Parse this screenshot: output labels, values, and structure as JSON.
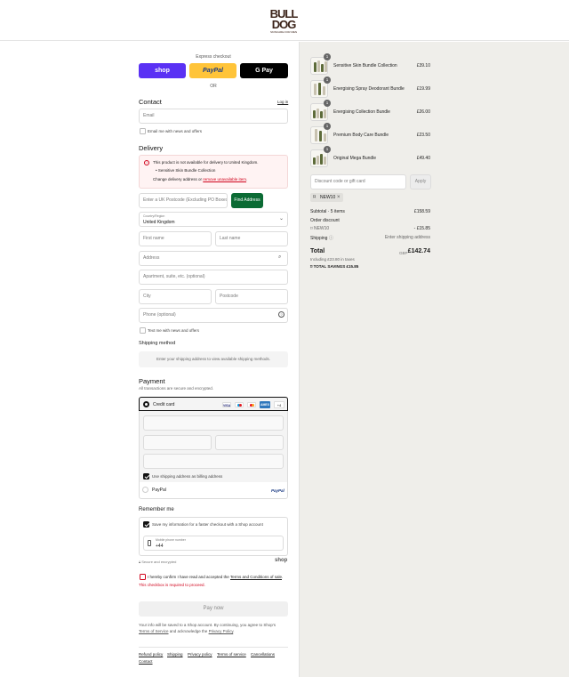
{
  "brand": {
    "logo_line1": "BULL",
    "logo_line2": "DOG",
    "logo_tagline": "SKINCARE FOR MEN",
    "logo_color": "#3b2319"
  },
  "express": {
    "label": "Express checkout",
    "shop_label": "shop",
    "paypal_label": "PayPal",
    "gpay_label": "G Pay",
    "or_label": "OR"
  },
  "contact": {
    "title": "Contact",
    "login_link": "Log in",
    "email_placeholder": "Email",
    "news_label": "Email me with news and offers",
    "news_checked": false
  },
  "delivery": {
    "title": "Delivery",
    "warning_title": "This product is not available for delivery to United Kingdom.",
    "warning_item": "Sensitive Skin Bundle Collection",
    "warning_change_prefix": "Change delivery address or ",
    "warning_change_link": "remove unavailable item",
    "warning_change_suffix": ".",
    "postcode_placeholder": "Enter a UK Postcode (Excluding PO Boxes)",
    "find_address_label": "Find Address",
    "country_label": "Country/Region",
    "country_value": "United Kingdom",
    "first_name": "First name",
    "last_name": "Last name",
    "address": "Address",
    "apartment": "Apartment, suite, etc. (optional)",
    "city": "City",
    "postcode": "Postcode",
    "phone": "Phone (optional)",
    "text_label": "Text me with news and offers"
  },
  "shipping": {
    "title": "Shipping method",
    "placeholder": "Enter your shipping address to view available shipping methods."
  },
  "payment": {
    "title": "Payment",
    "subtitle": "All transactions are secure and encrypted.",
    "credit_card_label": "Credit card",
    "card_icons": [
      "VISA",
      "maestro",
      "mastercard",
      "AMEX"
    ],
    "more_label": "+4",
    "billing_label": "Use shipping address as billing address",
    "paypal_label": "PayPal",
    "paypal_logo": "PayPal"
  },
  "remember": {
    "title": "Remember me",
    "save_label": "Save my information for a faster checkout with a Shop account",
    "mobile_label": "Mobile phone number",
    "mobile_value": "+44",
    "secure_label": "Secure and encrypted",
    "shop_logo": "shop"
  },
  "terms": {
    "prefix": "I hereby confirm I have read and accepted the ",
    "link": "Terms and Conditions of sale",
    "suffix": ".",
    "error": "This checkbox is required to proceed."
  },
  "pay_now_label": "Pay now",
  "disclaimer": {
    "line1": "Your info will be saved to a Shop account. By continuing, you agree to Shop's",
    "tos_link": "Terms of Service",
    "middle": " and acknowledge the ",
    "privacy_link": "Privacy Policy",
    "end": "."
  },
  "footer_links": [
    "Refund policy",
    "Shipping",
    "Privacy policy",
    "Terms of service",
    "Cancellations",
    "Contact"
  ],
  "cart": {
    "items": [
      {
        "name": "Sensitive Skin Bundle Collection",
        "price": "£39.10",
        "qty": "1"
      },
      {
        "name": "Energising Spray Deodorant Bundle",
        "price": "£19.99",
        "qty": "1"
      },
      {
        "name": "Energising Collection Bundle",
        "price": "£26.00",
        "qty": "1"
      },
      {
        "name": "Premium Body Care Bundle",
        "price": "£23.50",
        "qty": "1"
      },
      {
        "name": "Original Mega Bundle",
        "price": "£49.40",
        "qty": "1"
      }
    ],
    "discount_placeholder": "Discount code or gift card",
    "apply_label": "Apply",
    "code_tag": "NEW10",
    "subtotal_label": "Subtotal · 5 items",
    "subtotal_value": "£158.59",
    "order_discount_label": "Order discount",
    "code_line": "NEW10",
    "discount_value": "- £15.85",
    "shipping_label": "Shipping",
    "shipping_value": "Enter shipping address",
    "total_label": "Total",
    "currency": "GBP",
    "total_value": "£142.74",
    "taxes_label": "Including £23.80 in taxes",
    "savings_label": "TOTAL SAVINGS",
    "savings_value": "£15.85"
  },
  "colors": {
    "shop": "#5a31f4",
    "paypal": "#ffc439",
    "gpay": "#000000",
    "find_address": "#0b6b34",
    "error": "#d0021b",
    "warning_bg": "#fff3f3"
  }
}
